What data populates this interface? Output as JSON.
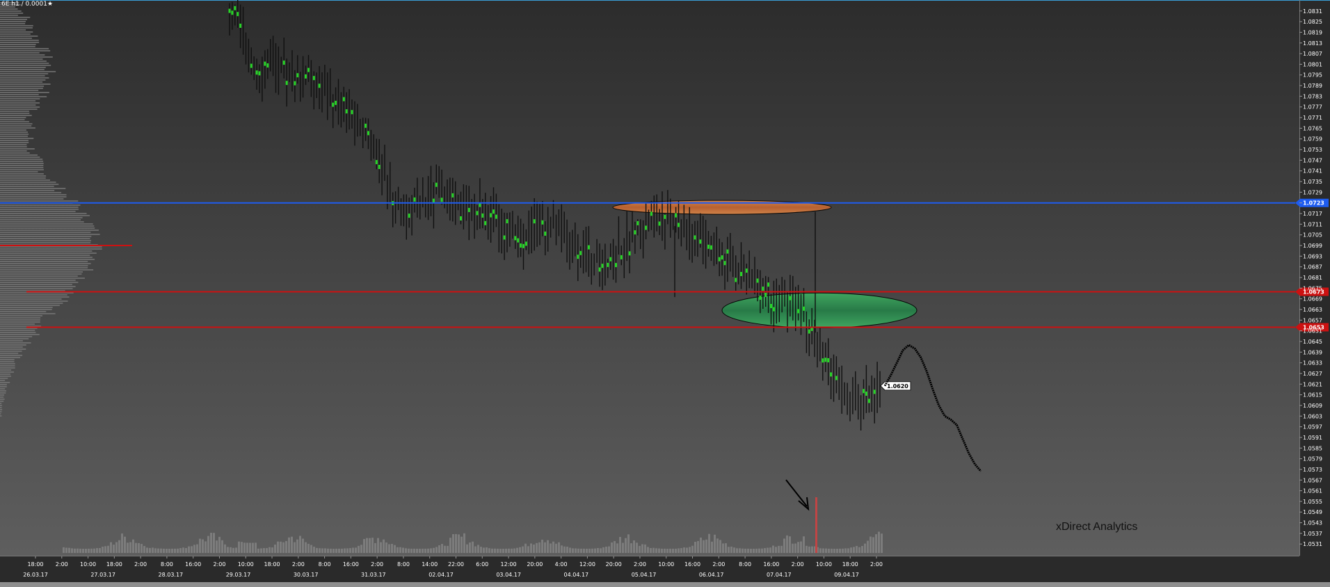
{
  "title": "6E h1 / 0.0001★",
  "watermark": "xDirect Analytics",
  "colors": {
    "bg_top": "#2f2f2f",
    "bg_bottom": "#5c5c5c",
    "candle": "#101010",
    "candle_up_accent": "#27d627",
    "blue_line": "#1e5cf0",
    "red_line": "#cc1111",
    "orange_zone": "#d9773a",
    "green_zone": "#2b9e55",
    "volume": "#8a8a8a",
    "axis_text": "#ffffff"
  },
  "chart_data": {
    "type": "candlestick",
    "instrument": "6E",
    "timeframe": "h1",
    "tick_size": "0.0001",
    "y_ticks": [
      "1.0831",
      "1.0825",
      "1.0819",
      "1.0813",
      "1.0807",
      "1.0801",
      "1.0795",
      "1.0789",
      "1.0783",
      "1.0777",
      "1.0771",
      "1.0765",
      "1.0759",
      "1.0753",
      "1.0747",
      "1.0741",
      "1.0735",
      "1.0729",
      "1.0723",
      "1.0717",
      "1.0711",
      "1.0705",
      "1.0699",
      "1.0693",
      "1.0687",
      "1.0681",
      "1.0675",
      "1.0669",
      "1.0663",
      "1.0657",
      "1.0651",
      "1.0645",
      "1.0639",
      "1.0633",
      "1.0627",
      "1.0621",
      "1.0615",
      "1.0609",
      "1.0603",
      "1.0597",
      "1.0591",
      "1.0585",
      "1.0579",
      "1.0573",
      "1.0567",
      "1.0561",
      "1.0555",
      "1.0549",
      "1.0543",
      "1.0537",
      "1.0531"
    ],
    "ylim": [
      1.0526,
      1.0836
    ],
    "x_ticks": [
      "18:00",
      "2:00",
      "10:00",
      "18:00",
      "2:00",
      "8:00",
      "16:00",
      "2:00",
      "10:00",
      "18:00",
      "2:00",
      "8:00",
      "16:00",
      "2:00",
      "8:00",
      "14:00",
      "22:00",
      "6:00",
      "12:00",
      "20:00",
      "4:00",
      "12:00",
      "20:00",
      "2:00",
      "10:00",
      "16:00",
      "2:00",
      "8:00",
      "16:00",
      "2:00",
      "10:00",
      "18:00",
      "2:00"
    ],
    "date_labels": [
      "26.03.17",
      "27.03.17",
      "28.03.17",
      "29.03.17",
      "30.03.17",
      "31.03.17",
      "02.04.17",
      "03.04.17",
      "04.04.17",
      "05.04.17",
      "06.04.17",
      "07.04.17",
      "09.04.17"
    ],
    "price_levels": [
      {
        "name": "blue-level",
        "value": 1.0723,
        "label": "1.0723",
        "color": "#1e5cf0"
      },
      {
        "name": "red-level-upper",
        "value": 1.0673,
        "label": "1.0673",
        "color": "#cc1111"
      },
      {
        "name": "red-level-lower",
        "value": 1.0653,
        "label": "1.0653",
        "color": "#cc1111"
      }
    ],
    "current_price": "1.0620",
    "zones": [
      {
        "name": "orange-zone",
        "color": "#d9773a",
        "price_low": 1.0717,
        "price_high": 1.0724
      },
      {
        "name": "green-zone",
        "color": "#2b9e55",
        "price_low": 1.0653,
        "price_high": 1.0672
      }
    ],
    "close_path": [
      1.0832,
      1.0826,
      1.082,
      1.0813,
      1.0805,
      1.08,
      1.0798,
      1.0803,
      1.08,
      1.0797,
      1.0795,
      1.0793,
      1.079,
      1.0794,
      1.0798,
      1.0795,
      1.079,
      1.0786,
      1.0782,
      1.078,
      1.0778,
      1.0775,
      1.0773,
      1.077,
      1.0766,
      1.076,
      1.0754,
      1.0745,
      1.0735,
      1.0728,
      1.0724,
      1.0722,
      1.072,
      1.0718,
      1.072,
      1.0723,
      1.0725,
      1.0728,
      1.073,
      1.0727,
      1.0723,
      1.072,
      1.0718,
      1.0715,
      1.0717,
      1.0719,
      1.0716,
      1.0713,
      1.0711,
      1.0709,
      1.0707,
      1.0705,
      1.0702,
      1.0705,
      1.0708,
      1.071,
      1.0712,
      1.0711,
      1.0709,
      1.0706,
      1.0703,
      1.07,
      1.0698,
      1.0696,
      1.0694,
      1.0692,
      1.069,
      1.0688,
      1.069,
      1.0693,
      1.0696,
      1.0699,
      1.0702,
      1.0705,
      1.0708,
      1.0711,
      1.0713,
      1.0715,
      1.0717,
      1.0716,
      1.0714,
      1.0712,
      1.071,
      1.0707,
      1.0705,
      1.0702,
      1.07,
      1.0697,
      1.0694,
      1.0691,
      1.0689,
      1.0686,
      1.0683,
      1.0681,
      1.0679,
      1.0677,
      1.0675,
      1.0673,
      1.067,
      1.0668,
      1.0666,
      1.0664,
      1.0662,
      1.066,
      1.0656,
      1.065,
      1.0644,
      1.0637,
      1.063,
      1.0624,
      1.0619,
      1.0616,
      1.0613,
      1.0611,
      1.0612,
      1.0615,
      1.0618,
      1.062
    ],
    "forecast_path": [
      1.062,
      1.0626,
      1.0633,
      1.064,
      1.0643,
      1.0641,
      1.0636,
      1.0628,
      1.0618,
      1.0609,
      1.0603,
      1.0601,
      1.0598,
      1.059,
      1.0582,
      1.0576,
      1.0572
    ],
    "volume_arrow_annotation": true
  }
}
